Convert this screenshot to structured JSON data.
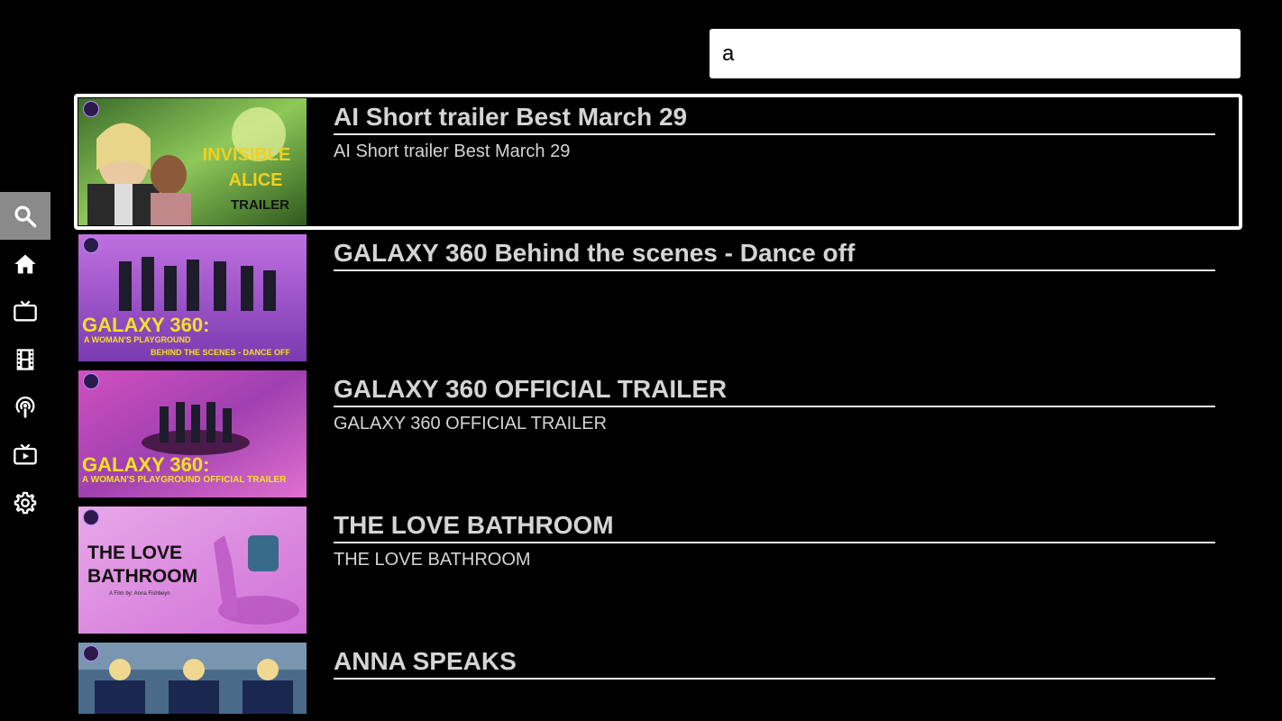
{
  "search": {
    "value": "a",
    "placeholder": ""
  },
  "sidebar": {
    "items": [
      {
        "name": "search",
        "icon": "search-icon",
        "active": true
      },
      {
        "name": "home",
        "icon": "home-icon",
        "active": false
      },
      {
        "name": "tv",
        "icon": "tv-icon",
        "active": false
      },
      {
        "name": "movies",
        "icon": "film-icon",
        "active": false
      },
      {
        "name": "podcasts",
        "icon": "podcast-icon",
        "active": false
      },
      {
        "name": "live",
        "icon": "live-tv-icon",
        "active": false
      },
      {
        "name": "settings",
        "icon": "gear-icon",
        "active": false
      }
    ]
  },
  "results": [
    {
      "title": "AI Short trailer Best March 29",
      "subtitle": "AI Short trailer Best March 29",
      "thumb_text": [
        "INVISIBLE",
        "ALICE",
        "TRAILER"
      ]
    },
    {
      "title": "GALAXY 360 Behind the scenes - Dance off",
      "subtitle": "",
      "thumb_text": [
        "GALAXY 360:",
        "A WOMAN'S PLAYGROUND",
        "BEHIND THE SCENES - DANCE OFF"
      ]
    },
    {
      "title": "GALAXY 360 OFFICIAL TRAILER",
      "subtitle": "GALAXY 360 OFFICIAL TRAILER",
      "thumb_text": [
        "GALAXY 360:",
        "A WOMAN'S PLAYGROUND OFFICIAL TRAILER"
      ]
    },
    {
      "title": "THE LOVE BATHROOM",
      "subtitle": "THE LOVE BATHROOM",
      "thumb_text": [
        "THE LOVE",
        "BATHROOM",
        "A Film by: Anna Fishbeyn"
      ]
    },
    {
      "title": "ANNA SPEAKS",
      "subtitle": "",
      "thumb_text": []
    }
  ],
  "colors": {
    "background": "#000000",
    "active_nav": "#8a8a8a",
    "title_text": "#d4d4d4",
    "search_bg": "#ffffff"
  }
}
